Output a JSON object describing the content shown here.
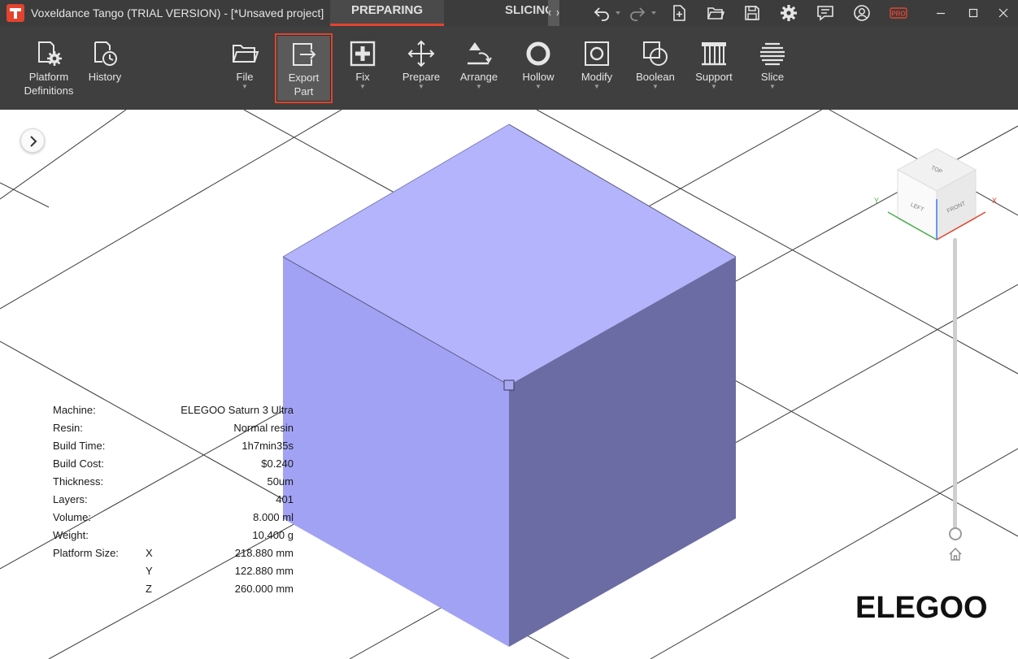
{
  "window": {
    "title": "Voxeldance Tango (TRIAL VERSION) - [*Unsaved project]",
    "modes": [
      {
        "label": "PREPARING",
        "active": true
      },
      {
        "label": "SLICING",
        "active": false
      }
    ],
    "toolbar_icons": [
      "undo-icon",
      "redo-icon",
      "new-file-icon",
      "open-folder-icon",
      "save-icon",
      "settings-gear-icon",
      "feedback-icon",
      "account-icon",
      "pro-badge-icon"
    ],
    "pro_badge": "PRO",
    "controls": [
      "minimize",
      "maximize",
      "close"
    ]
  },
  "ribbon": {
    "left": [
      {
        "label": "Platform\nDefinitions",
        "icon": "platform-definitions-icon"
      },
      {
        "label": "History",
        "icon": "history-icon"
      }
    ],
    "main": [
      {
        "label": "File",
        "icon": "folder-icon",
        "dropdown": true
      },
      {
        "label": "Export\nPart",
        "icon": "export-icon",
        "dropdown": false,
        "selected": true
      },
      {
        "label": "Fix",
        "icon": "fix-plus-icon",
        "dropdown": true
      },
      {
        "label": "Prepare",
        "icon": "move-arrows-icon",
        "dropdown": true
      },
      {
        "label": "Arrange",
        "icon": "arrange-icon",
        "dropdown": true
      },
      {
        "label": "Hollow",
        "icon": "hollow-ring-icon",
        "dropdown": true
      },
      {
        "label": "Modify",
        "icon": "modify-icon",
        "dropdown": true
      },
      {
        "label": "Boolean",
        "icon": "boolean-icon",
        "dropdown": true
      },
      {
        "label": "Support",
        "icon": "support-icon",
        "dropdown": true
      },
      {
        "label": "Slice",
        "icon": "slice-icon",
        "dropdown": true
      }
    ],
    "accent_color": "#e2442f"
  },
  "info": {
    "machine_label": "Machine:",
    "machine": "ELEGOO Saturn 3 Ultra",
    "resin_label": "Resin:",
    "resin": "Normal resin",
    "build_time_label": "Build Time:",
    "build_time": "1h7min35s",
    "build_cost_label": "Build Cost:",
    "build_cost": "$0.240",
    "thickness_label": "Thickness:",
    "thickness": "50um",
    "layers_label": "Layers:",
    "layers": "401",
    "volume_label": "Volume:",
    "volume": "8.000 ml",
    "weight_label": "Weight:",
    "weight": "10.400 g",
    "platform_size_label": "Platform Size:",
    "platform_x_axis": "X",
    "platform_x": "218.880 mm",
    "platform_y_axis": "Y",
    "platform_y": "122.880 mm",
    "platform_z_axis": "Z",
    "platform_z": "260.000 mm"
  },
  "navcube": {
    "top": "TOP",
    "left": "LEFT",
    "front": "FRONT",
    "x_axis": "X",
    "y_axis": "Y"
  },
  "brand": "ELEGOO",
  "colors": {
    "cube_top": "#b4b4fd",
    "cube_left": "#a2a2f4",
    "cube_right": "#6c6ca4",
    "titlebar": "#3c3c3c",
    "ribbon": "#3f3f3f"
  }
}
